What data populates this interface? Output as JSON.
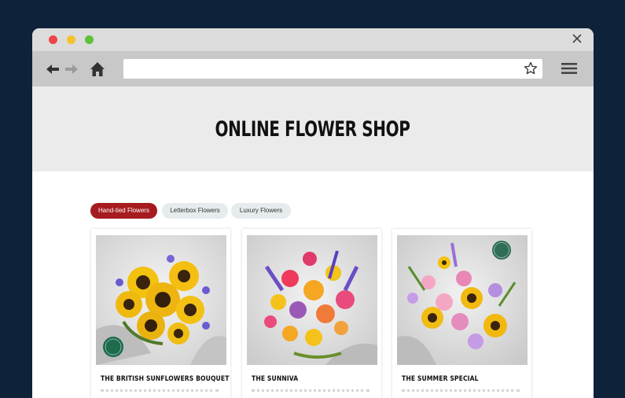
{
  "colors": {
    "background": "#0e2239",
    "titlebar": "#dcdcdc",
    "toolbar": "#c8c8c8",
    "hero": "#ebebeb",
    "accent": "#a51b1f",
    "tab_inactive": "#e6ebee",
    "dot_red": "#ee4349",
    "dot_yellow": "#f5c22b",
    "dot_green": "#5fc138",
    "icon_dark": "#333333",
    "icon_light": "#9a9a9a"
  },
  "browser": {
    "window_controls": [
      "close-dot",
      "minimize-dot",
      "maximize-dot"
    ],
    "icons": {
      "back": "arrow-left-icon",
      "forward": "arrow-right-icon",
      "home": "home-icon",
      "bookmark": "star-icon",
      "menu": "hamburger-menu-icon",
      "close": "close-icon"
    },
    "address_value": ""
  },
  "page": {
    "title": "ONLINE FLOWER SHOP",
    "tabs": [
      {
        "label": "Hand-tied Flowers",
        "active": true
      },
      {
        "label": "Letterbox Flowers",
        "active": false
      },
      {
        "label": "Luxury Flowers",
        "active": false
      }
    ],
    "products": [
      {
        "name": "THE BRITISH SUNFLOWERS BOUQUET",
        "badge": "British Sunflowers",
        "badge_color": "#1e6b4e"
      },
      {
        "name": "THE SUNNIVA"
      },
      {
        "name": "THE SUMMER SPECIAL",
        "badge": "The UK",
        "badge_color": "#2f6e55"
      }
    ]
  }
}
